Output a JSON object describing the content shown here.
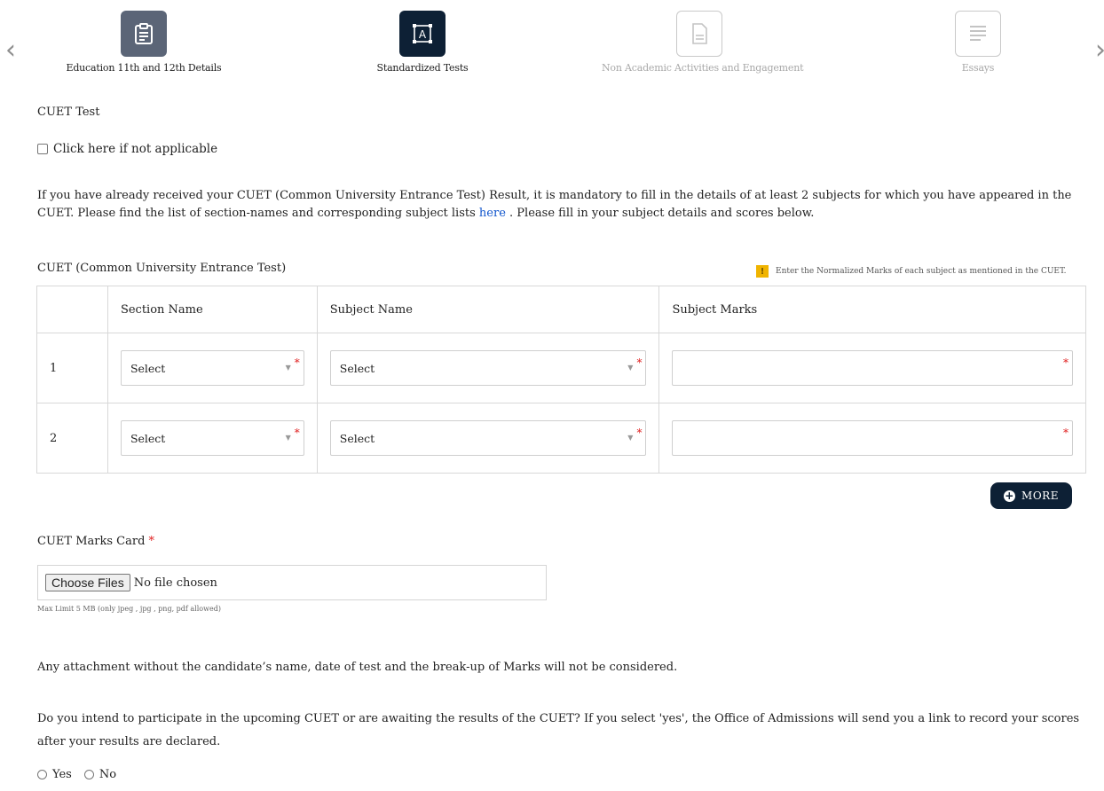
{
  "stepper": {
    "steps": [
      {
        "label": "Education 11th and 12th Details",
        "icon": "clipboard-icon",
        "state": "done"
      },
      {
        "label": "Standardized Tests",
        "icon": "test-icon",
        "state": "active"
      },
      {
        "label": "Non Academic Activities and Engagement",
        "icon": "document-icon",
        "state": "todo"
      },
      {
        "label": "Essays",
        "icon": "text-lines-icon",
        "state": "todo"
      }
    ],
    "prev_arrow": "‹",
    "next_arrow": "›"
  },
  "cuet": {
    "section_title": "CUET Test",
    "not_applicable_label": "Click here if not applicable",
    "instructions_before_link": "If you have already received your CUET (Common University Entrance Test) Result, it is mandatory to fill in the details of at least 2 subjects for which you have appeared in the CUET. Please find the list of section-names and corresponding subject lists ",
    "instructions_link": "here",
    "instructions_after_link": " . Please fill in your subject details and scores below.",
    "table_title": "CUET (Common University Entrance Test)",
    "hint": "Enter the Normalized Marks of each subject as mentioned in the CUET.",
    "hint_icon": "!",
    "columns": [
      "",
      "Section Name",
      "Subject Name",
      "Subject Marks"
    ],
    "rows": [
      {
        "num": "1",
        "section": "Select",
        "subject": "Select",
        "marks": ""
      },
      {
        "num": "2",
        "section": "Select",
        "subject": "Select",
        "marks": ""
      }
    ],
    "required_mark": "*",
    "more_label": "MORE",
    "more_icon": "+",
    "marks_card_label": "CUET Marks Card",
    "choose_files_label": "Choose Files",
    "no_file_text": "No file chosen",
    "file_note": "Max Limit 5 MB (only jpeg , jpg , png, pdf allowed)",
    "attachment_note": "Any attachment without the candidate’s name, date of test and the break-up of Marks will not be considered.",
    "upcoming_question": "Do you intend to participate in the upcoming CUET or are awaiting the results of the CUET? If you select 'yes', the Office of Admissions will send you a link to record your scores after your results are declared.",
    "yes_label": "Yes",
    "no_label": "No"
  },
  "colors": {
    "active_step": "#0d2035",
    "done_step": "#5b6577",
    "required": "#e02020",
    "link": "#1155cc",
    "hint_icon": "#f0b400"
  }
}
